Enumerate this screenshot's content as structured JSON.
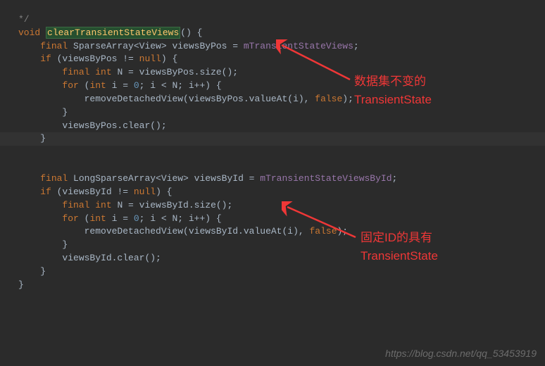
{
  "code": {
    "comment_end": "*/",
    "l1_void": "void",
    "l1_name": "clearTransientStateViews",
    "l1_rest": "() {",
    "l2_final": "final",
    "l2_rest1": " SparseArray<View> viewsByPos = ",
    "l2_field": "mTransientStateViews",
    "l3_if": "if",
    "l3_rest1": " (viewsByPos != ",
    "l3_null": "null",
    "l3_rest2": ") {",
    "l4_final": "final int",
    "l4_rest": " N = viewsByPos.size();",
    "l5_for": "for",
    "l5_open": " (",
    "l5_int": "int",
    "l5_i": " i = ",
    "l5_zero": "0",
    "l5_semi": "; i < N; i++) {",
    "l6": "removeDetachedView(viewsByPos.valueAt(i), ",
    "l6_false": "false",
    "l6_end": ");",
    "l7": "}",
    "l8": "viewsByPos.clear();",
    "l9": "}",
    "l11_final": "final",
    "l11_rest1": " LongSparseArray<View> viewsById = ",
    "l11_field": "mTransientStateViewsById",
    "l12_if": "if",
    "l12_rest1": " (viewsById != ",
    "l12_null": "null",
    "l12_rest2": ") {",
    "l13_final": "final int",
    "l13_rest": " N = viewsById.size();",
    "l14_for": "for",
    "l14_open": " (",
    "l14_int": "int",
    "l14_i": " i = ",
    "l14_zero": "0",
    "l14_semi": "; i < N; i++) {",
    "l15": "removeDetachedView(viewsById.valueAt(i), ",
    "l15_false": "false",
    "l15_end": ");",
    "l16": "}",
    "l17": "viewsById.clear();",
    "l18": "}",
    "l19": "}"
  },
  "annotations": {
    "anno1_line1": "数据集不变的",
    "anno1_line2": "TransientState",
    "anno2_line1": "固定ID的具有",
    "anno2_line2": "TransientState"
  },
  "watermark": "https://blog.csdn.net/qq_53453919"
}
